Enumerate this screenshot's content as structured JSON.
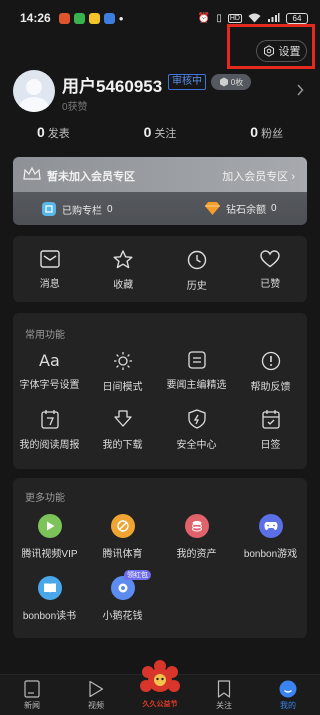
{
  "status_bar": {
    "time": "14:26",
    "network": "HD",
    "battery": "64"
  },
  "settings": {
    "label": "设置"
  },
  "profile": {
    "username": "用户5460953",
    "review_badge": "审核中",
    "level_badge": "0枚",
    "likes": "0获赞"
  },
  "stats": [
    {
      "value": "0",
      "label": "发表"
    },
    {
      "value": "0",
      "label": "关注"
    },
    {
      "value": "0",
      "label": "粉丝"
    }
  ],
  "vip": {
    "status": "暂未加入会员专区",
    "join_label": "加入会员专区",
    "purchased_label": "已购专栏",
    "purchased_value": "0",
    "diamond_label": "钻石余额",
    "diamond_value": "0"
  },
  "quick": [
    {
      "label": "消息",
      "icon": "message-icon"
    },
    {
      "label": "收藏",
      "icon": "star-icon"
    },
    {
      "label": "历史",
      "icon": "clock-icon"
    },
    {
      "label": "已赞",
      "icon": "heart-icon"
    }
  ],
  "common": {
    "title": "常用功能",
    "items": [
      {
        "label": "字体字号设置",
        "icon": "font-icon"
      },
      {
        "label": "日间模式",
        "icon": "sun-icon"
      },
      {
        "label": "要闻主编精选",
        "icon": "editor-icon"
      },
      {
        "label": "帮助反馈",
        "icon": "help-icon"
      },
      {
        "label": "我的阅读周报",
        "icon": "calendar-7-icon"
      },
      {
        "label": "我的下载",
        "icon": "download-icon"
      },
      {
        "label": "安全中心",
        "icon": "shield-icon"
      },
      {
        "label": "日签",
        "icon": "daily-sign-icon"
      }
    ]
  },
  "more": {
    "title": "更多功能",
    "items": [
      {
        "label": "腾讯视频VIP",
        "icon": "video-play-icon",
        "color": "#7cc35a"
      },
      {
        "label": "腾讯体育",
        "icon": "sports-icon",
        "color": "#f0a431"
      },
      {
        "label": "我的资产",
        "icon": "assets-icon",
        "color": "#e0626a"
      },
      {
        "label": "bonbon游戏",
        "icon": "gamepad-icon",
        "color": "#5b6fe6"
      },
      {
        "label": "bonbon读书",
        "icon": "book-icon",
        "color": "#4aa7ea"
      },
      {
        "label": "小鹅花钱",
        "icon": "goose-icon",
        "color": "#5d8cf0",
        "tag": "领红包"
      }
    ]
  },
  "nav": [
    {
      "label": "新闻",
      "icon": "news-tab-icon"
    },
    {
      "label": "视频",
      "icon": "video-tab-icon"
    },
    {
      "label": "久久公益节",
      "icon": "charity-festival-icon"
    },
    {
      "label": "关注",
      "icon": "follow-tab-icon"
    },
    {
      "label": "我的",
      "icon": "profile-tab-icon"
    }
  ],
  "colors": {
    "accent_blue": "#3a83f0",
    "highlight_red": "#e4291e",
    "background": "#161616",
    "card": "#232323"
  }
}
